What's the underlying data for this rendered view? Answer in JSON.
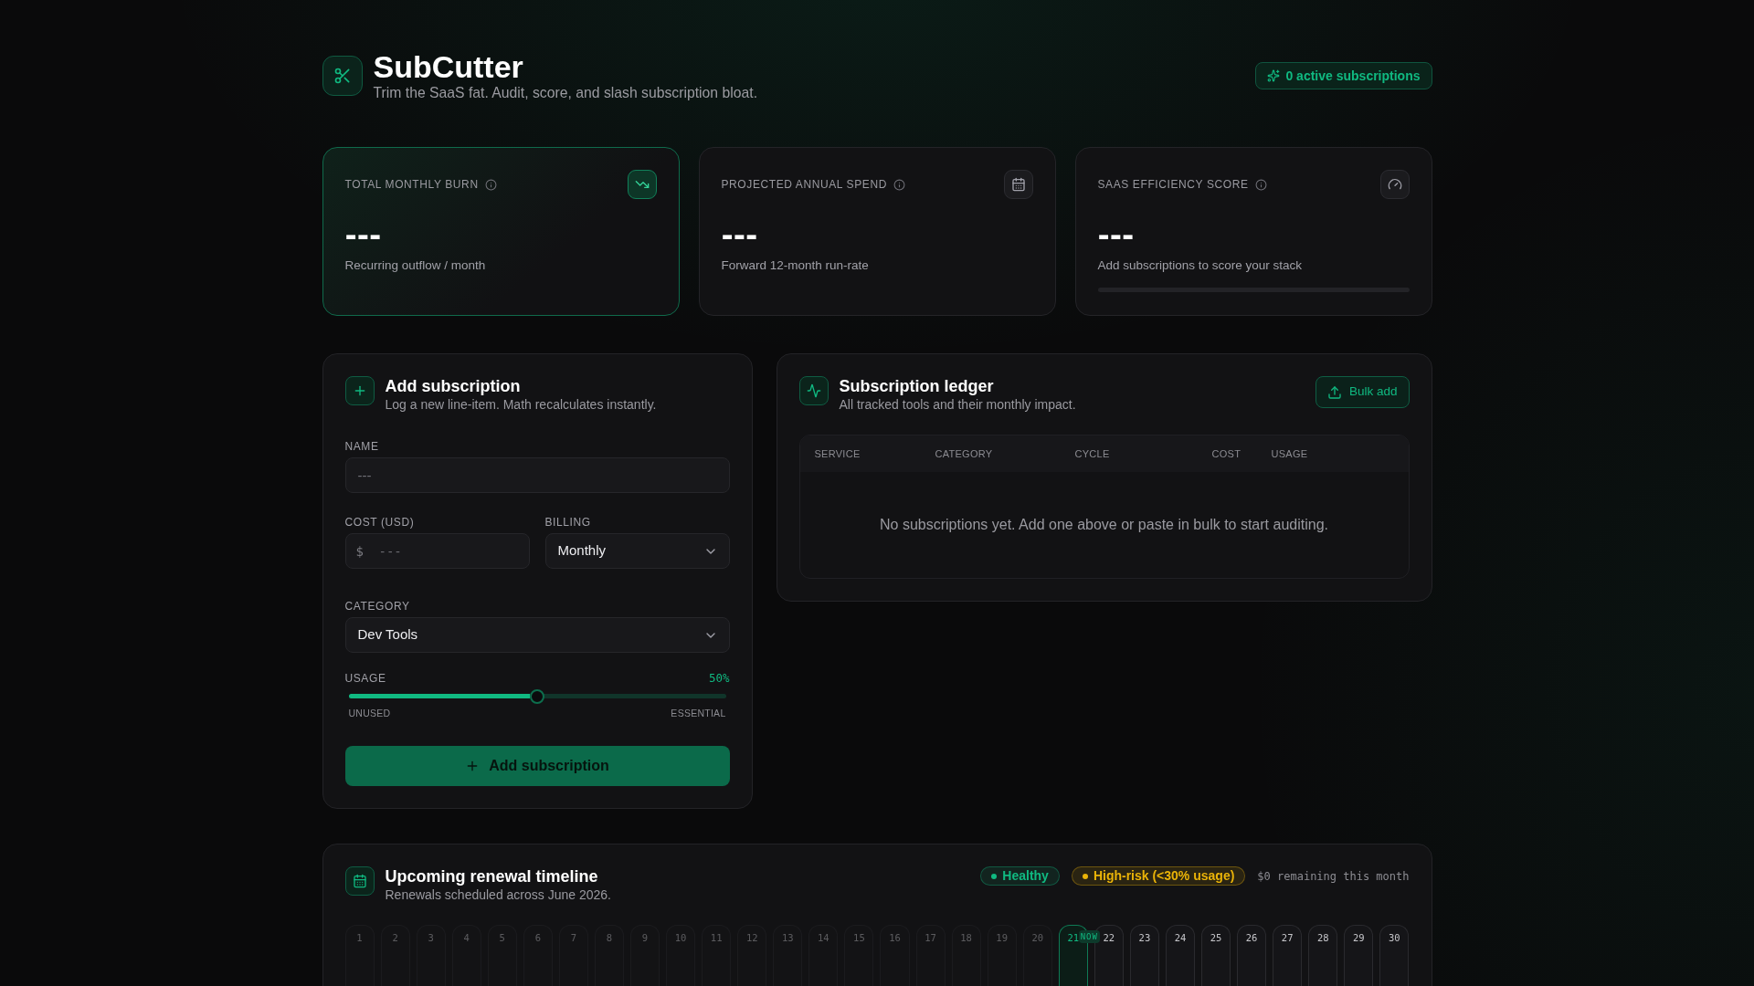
{
  "header": {
    "title": "SubCutter",
    "subtitle": "Trim the SaaS fat. Audit, score, and slash subscription bloat.",
    "badge": "0 active subscriptions"
  },
  "stats": [
    {
      "kind": "burn",
      "label": "TOTAL MONTHLY BURN",
      "value": "---",
      "caption": "Recurring outflow / month",
      "highlighted": true
    },
    {
      "kind": "annual",
      "label": "PROJECTED ANNUAL SPEND",
      "value": "---",
      "caption": "Forward 12-month run-rate",
      "highlighted": false
    },
    {
      "kind": "score",
      "label": "SAAS EFFICIENCY SCORE",
      "value": "---",
      "caption": "Add subscriptions to score your stack",
      "highlighted": false
    }
  ],
  "add_form": {
    "title": "Add subscription",
    "subtitle": "Log a new line-item. Math recalculates instantly.",
    "name": {
      "label": "NAME",
      "placeholder": "---"
    },
    "cost": {
      "label": "COST (USD)",
      "prefix": "$",
      "placeholder": "---"
    },
    "billing": {
      "label": "BILLING",
      "value": "Monthly"
    },
    "category": {
      "label": "CATEGORY",
      "value": "Dev Tools"
    },
    "usage": {
      "label": "USAGE",
      "reading": "50%",
      "level": 0.5,
      "min_label": "UNUSED",
      "max_label": "ESSENTIAL"
    },
    "submit": "Add subscription"
  },
  "ledger": {
    "title": "Subscription ledger",
    "subtitle": "All tracked tools and their monthly impact.",
    "bulk_button": "Bulk add",
    "table": {
      "columns": [
        "SERVICE",
        "CATEGORY",
        "CYCLE",
        "COST",
        "USAGE"
      ],
      "empty_message": "No subscriptions yet. Add one above or paste in bulk to start auditing."
    }
  },
  "timeline": {
    "title": "Upcoming renewal timeline",
    "subtitle": "Renewals scheduled across June 2026.",
    "legend": [
      {
        "label": "Healthy",
        "color": "#10b981"
      },
      {
        "label": "High-risk (<30% usage)",
        "color": "#eab308"
      }
    ],
    "remaining": "$0 remaining this month",
    "days": [
      {
        "label": "1",
        "past": true,
        "today": false
      },
      {
        "label": "2",
        "past": true,
        "today": false
      },
      {
        "label": "3",
        "past": true,
        "today": false
      },
      {
        "label": "4",
        "past": true,
        "today": false
      },
      {
        "label": "5",
        "past": true,
        "today": false
      },
      {
        "label": "6",
        "past": true,
        "today": false
      },
      {
        "label": "7",
        "past": true,
        "today": false
      },
      {
        "label": "8",
        "past": true,
        "today": false
      },
      {
        "label": "9",
        "past": true,
        "today": false
      },
      {
        "label": "10",
        "past": true,
        "today": false
      },
      {
        "label": "11",
        "past": true,
        "today": false
      },
      {
        "label": "12",
        "past": true,
        "today": false
      },
      {
        "label": "13",
        "past": true,
        "today": false
      },
      {
        "label": "14",
        "past": true,
        "today": false
      },
      {
        "label": "15",
        "past": true,
        "today": false
      },
      {
        "label": "16",
        "past": true,
        "today": false
      },
      {
        "label": "17",
        "past": true,
        "today": false
      },
      {
        "label": "18",
        "past": true,
        "today": false
      },
      {
        "label": "19",
        "past": true,
        "today": false
      },
      {
        "label": "20",
        "past": true,
        "today": false
      },
      {
        "label": "21",
        "past": false,
        "today": true,
        "badge": "NOW"
      },
      {
        "label": "22",
        "past": false,
        "today": false
      },
      {
        "label": "23",
        "past": false,
        "today": false
      },
      {
        "label": "24",
        "past": false,
        "today": false
      },
      {
        "label": "25",
        "past": false,
        "today": false
      },
      {
        "label": "26",
        "past": false,
        "today": false
      },
      {
        "label": "27",
        "past": false,
        "today": false
      },
      {
        "label": "28",
        "past": false,
        "today": false
      },
      {
        "label": "29",
        "past": false,
        "today": false
      },
      {
        "label": "30",
        "past": false,
        "today": false
      }
    ]
  }
}
